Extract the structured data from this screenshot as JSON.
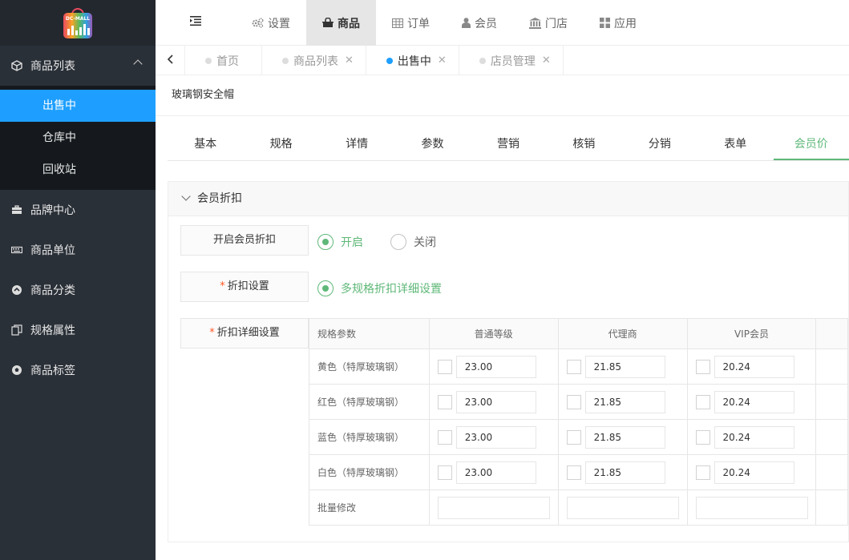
{
  "logo": {
    "text": "DC-MALL"
  },
  "sidebar": {
    "group": {
      "label": "商品列表",
      "icon": "cube-icon"
    },
    "subitems": [
      {
        "label": "出售中",
        "active": true
      },
      {
        "label": "仓库中",
        "active": false
      },
      {
        "label": "回收站",
        "active": false
      }
    ],
    "items": [
      {
        "label": "品牌中心",
        "icon": "briefcase-icon"
      },
      {
        "label": "商品单位",
        "icon": "keyboard-icon"
      },
      {
        "label": "商品分类",
        "icon": "circle-arrow-icon"
      },
      {
        "label": "规格属性",
        "icon": "copy-icon"
      },
      {
        "label": "商品标签",
        "icon": "soccer-icon"
      }
    ]
  },
  "topnav": [
    {
      "label": "设置",
      "icon": "gears-icon",
      "active": false
    },
    {
      "label": "商品",
      "icon": "bag-icon",
      "active": true
    },
    {
      "label": "订单",
      "icon": "table-icon",
      "active": false
    },
    {
      "label": "会员",
      "icon": "user-icon",
      "active": false
    },
    {
      "label": "门店",
      "icon": "bank-icon",
      "active": false
    },
    {
      "label": "应用",
      "icon": "grid-icon",
      "active": false
    }
  ],
  "tabs": [
    {
      "label": "首页",
      "closable": false,
      "active": false
    },
    {
      "label": "商品列表",
      "closable": true,
      "active": false
    },
    {
      "label": "出售中",
      "closable": true,
      "active": true
    },
    {
      "label": "店员管理",
      "closable": true,
      "active": false
    }
  ],
  "product": {
    "title": "玻璃钢安全帽"
  },
  "product_tabs": [
    "基本",
    "规格",
    "详情",
    "参数",
    "营销",
    "核销",
    "分销",
    "表单",
    "会员价"
  ],
  "active_product_tab": "会员价",
  "panel": {
    "title": "会员折扣",
    "enable_label": "开启会员折扣",
    "enable_on": "开启",
    "enable_off": "关闭",
    "discount_label": "折扣设置",
    "discount_option": "多规格折扣详细设置",
    "detail_label": "折扣详细设置",
    "required_mark": "*"
  },
  "table": {
    "headers": [
      "规格参数",
      "普通等级",
      "代理商",
      "VIP会员"
    ],
    "rows": [
      {
        "spec": "黄色（特厚玻璃钢）",
        "values": [
          "23.00",
          "21.85",
          "20.24"
        ]
      },
      {
        "spec": "红色（特厚玻璃钢）",
        "values": [
          "23.00",
          "21.85",
          "20.24"
        ]
      },
      {
        "spec": "蓝色（特厚玻璃钢）",
        "values": [
          "23.00",
          "21.85",
          "20.24"
        ]
      },
      {
        "spec": "白色（特厚玻璃钢）",
        "values": [
          "23.00",
          "21.85",
          "20.24"
        ]
      }
    ],
    "batch_label": "批量修改"
  },
  "colors": {
    "sidebar_bg": "#2a3038",
    "active_blue": "#1e9fff",
    "accent_green": "#5FB878"
  }
}
